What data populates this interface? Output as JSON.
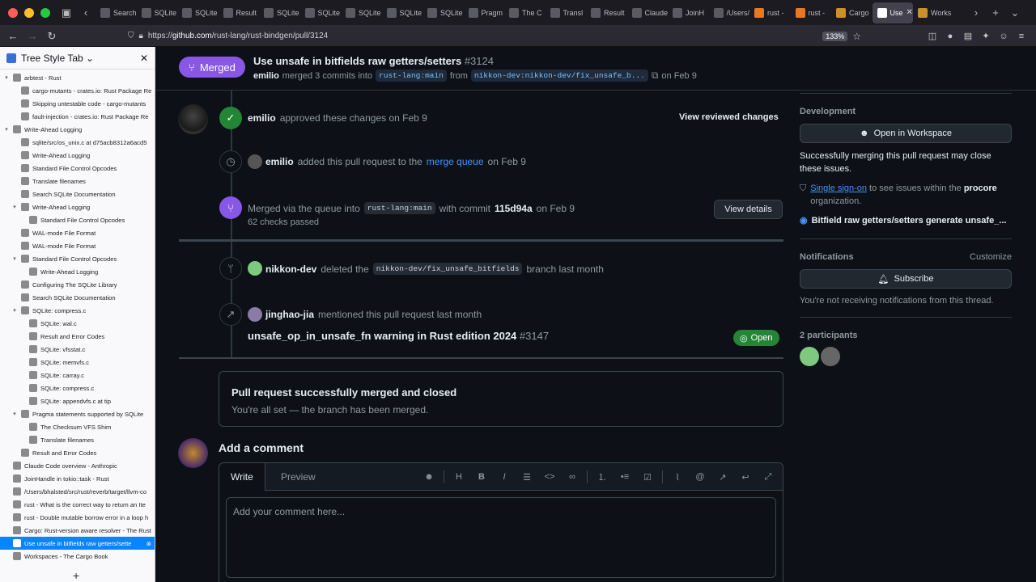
{
  "browser": {
    "tabs": [
      {
        "label": "Search",
        "icon": "sqlite-icon"
      },
      {
        "label": "SQLite",
        "icon": "sqlite-icon"
      },
      {
        "label": "SQLite",
        "icon": "sqlite-icon"
      },
      {
        "label": "Result",
        "icon": "sqlite-icon"
      },
      {
        "label": "SQLite",
        "icon": "sqlite-icon"
      },
      {
        "label": "SQLite",
        "icon": "sqlite-icon"
      },
      {
        "label": "SQLite",
        "icon": "sqlite-icon"
      },
      {
        "label": "SQLite",
        "icon": "sqlite-icon"
      },
      {
        "label": "SQLite",
        "icon": "sqlite-icon"
      },
      {
        "label": "Pragm",
        "icon": "sqlite-icon"
      },
      {
        "label": "The C",
        "icon": "sqlite-icon"
      },
      {
        "label": "Transl",
        "icon": "sqlite-icon"
      },
      {
        "label": "Result",
        "icon": "sqlite-icon"
      },
      {
        "label": "Claude",
        "icon": "anthropic-icon"
      },
      {
        "label": "JoinH",
        "icon": "docsrs-icon"
      },
      {
        "label": "/Users/bh",
        "icon": "file-icon"
      },
      {
        "label": "rust -",
        "icon": "stackoverflow-icon"
      },
      {
        "label": "rust -",
        "icon": "stackoverflow-icon"
      },
      {
        "label": "Cargo",
        "icon": "book-icon"
      },
      {
        "label": "Use",
        "icon": "github-icon",
        "active": true
      },
      {
        "label": "Works",
        "icon": "book-icon"
      }
    ],
    "url_prefix": "https://",
    "url_host": "github.com",
    "url_path": "/rust-lang/rust-bindgen/pull/3124",
    "zoom": "133%"
  },
  "sidebar": {
    "title": "Tree Style Tab",
    "items": [
      {
        "label": "arbtest - Rust",
        "level": 0,
        "twisty": "▾"
      },
      {
        "label": "cargo-mutants - crates.io: Rust Package Re",
        "level": 1,
        "twisty": ""
      },
      {
        "label": "Skipping untestable code - cargo-mutants",
        "level": 1,
        "twisty": ""
      },
      {
        "label": "fault-injection - crates.io: Rust Package Re",
        "level": 1,
        "twisty": ""
      },
      {
        "label": "Write-Ahead Logging",
        "level": 0,
        "twisty": "▾"
      },
      {
        "label": "sqlite/src/os_unix.c at d75acb8312a6acd5",
        "level": 1,
        "twisty": ""
      },
      {
        "label": "Write-Ahead Logging",
        "level": 1,
        "twisty": ""
      },
      {
        "label": "Standard File Control Opcodes",
        "level": 1,
        "twisty": ""
      },
      {
        "label": "Translate filenames",
        "level": 1,
        "twisty": ""
      },
      {
        "label": "Search SQLite Documentation",
        "level": 1,
        "twisty": ""
      },
      {
        "label": "Write-Ahead Logging",
        "level": 1,
        "twisty": "▾"
      },
      {
        "label": "Standard File Control Opcodes",
        "level": 2,
        "twisty": ""
      },
      {
        "label": "WAL-mode File Format",
        "level": 1,
        "twisty": ""
      },
      {
        "label": "WAL-mode File Format",
        "level": 1,
        "twisty": ""
      },
      {
        "label": "Standard File Control Opcodes",
        "level": 1,
        "twisty": "▾"
      },
      {
        "label": "Write-Ahead Logging",
        "level": 2,
        "twisty": ""
      },
      {
        "label": "Configuring The SQLite Library",
        "level": 1,
        "twisty": ""
      },
      {
        "label": "Search SQLite Documentation",
        "level": 1,
        "twisty": ""
      },
      {
        "label": "SQLite: compress.c",
        "level": 1,
        "twisty": "▾"
      },
      {
        "label": "SQLite: wal.c",
        "level": 2,
        "twisty": ""
      },
      {
        "label": "Result and Error Codes",
        "level": 2,
        "twisty": ""
      },
      {
        "label": "SQLite: vfsstat.c",
        "level": 2,
        "twisty": ""
      },
      {
        "label": "SQLite: memvfs.c",
        "level": 2,
        "twisty": ""
      },
      {
        "label": "SQLite: carray.c",
        "level": 2,
        "twisty": ""
      },
      {
        "label": "SQLite: compress.c",
        "level": 2,
        "twisty": ""
      },
      {
        "label": "SQLite: appendvfs.c at tip",
        "level": 2,
        "twisty": ""
      },
      {
        "label": "Pragma statements supported by SQLite",
        "level": 1,
        "twisty": "▾"
      },
      {
        "label": "The Checksum VFS Shim",
        "level": 2,
        "twisty": ""
      },
      {
        "label": "Translate filenames",
        "level": 2,
        "twisty": ""
      },
      {
        "label": "Result and Error Codes",
        "level": 1,
        "twisty": ""
      },
      {
        "label": "Claude Code overview - Anthropic",
        "level": 0,
        "twisty": ""
      },
      {
        "label": "JoinHandle in tokio::task - Rust",
        "level": 0,
        "twisty": ""
      },
      {
        "label": "/Users/bhalsted/src/rust/reverb/target/llvm-co",
        "level": 0,
        "twisty": ""
      },
      {
        "label": "rust - What is the correct way to return an Ite",
        "level": 0,
        "twisty": ""
      },
      {
        "label": "rust - Double mutable borrow error in a loop h",
        "level": 0,
        "twisty": ""
      },
      {
        "label": "Cargo: Rust-version aware resolver - The Rust",
        "level": 0,
        "twisty": ""
      },
      {
        "label": "Use unsafe in bitfields raw getters/sette",
        "level": 0,
        "twisty": "",
        "active": true
      },
      {
        "label": "Workspaces - The Cargo Book",
        "level": 0,
        "twisty": ""
      }
    ]
  },
  "pr": {
    "state": "Merged",
    "title": "Use unsafe in bitfields raw getters/setters",
    "number": "#3124",
    "author": "emilio",
    "meta_merged": "merged 3 commits into",
    "base_branch": "rust-lang:main",
    "from_word": "from",
    "head_branch": "nikkon-dev:nikkon-dev/fix_unsafe_b...",
    "merged_date": "on Feb 9"
  },
  "timeline": {
    "approve": {
      "user": "emilio",
      "text": "approved these changes on Feb 9",
      "button": "View reviewed changes"
    },
    "queue": {
      "user": "emilio",
      "text1": "added this pull request to the",
      "link": "merge queue",
      "text2": "on Feb 9"
    },
    "merged": {
      "text1": "Merged via the queue into",
      "branch": "rust-lang:main",
      "text2": "with commit",
      "commit": "115d94a",
      "text3": "on Feb 9",
      "checks": "62 checks passed",
      "button": "View details"
    },
    "deleted": {
      "user": "nikkon-dev",
      "text1": "deleted the",
      "branch": "nikkon-dev/fix_unsafe_bitfields",
      "text2": "branch last month"
    },
    "mentioned": {
      "user": "jinghao-jia",
      "text": "mentioned this pull request last month",
      "linked_title": "unsafe_op_in_unsafe_fn warning in Rust edition 2024",
      "linked_number": "#3147",
      "linked_state": "Open"
    }
  },
  "merge_box": {
    "title": "Pull request successfully merged and closed",
    "subtitle": "You're all set — the branch has been merged."
  },
  "comment": {
    "heading": "Add a comment",
    "tab_write": "Write",
    "tab_preview": "Preview",
    "placeholder": "Add your comment here..."
  },
  "right": {
    "development_heading": "Development",
    "workspace_button": "Open in Workspace",
    "merge_note": "Successfully merging this pull request may close these issues.",
    "sso_link": "Single sign-on",
    "sso_text": "to see issues within the",
    "org": "procore",
    "org_suffix": "organization.",
    "linked_issue": "Bitfield raw getters/setters generate unsafe_...",
    "notifications_heading": "Notifications",
    "customize": "Customize",
    "subscribe_button": "Subscribe",
    "not_receiving": "You're not receiving notifications from this thread.",
    "participants_heading": "2 participants"
  },
  "colors": {
    "merged_purple": "#8957e5",
    "open_green": "#238636",
    "approve_green": "#238636",
    "link_blue": "#4493f8"
  }
}
